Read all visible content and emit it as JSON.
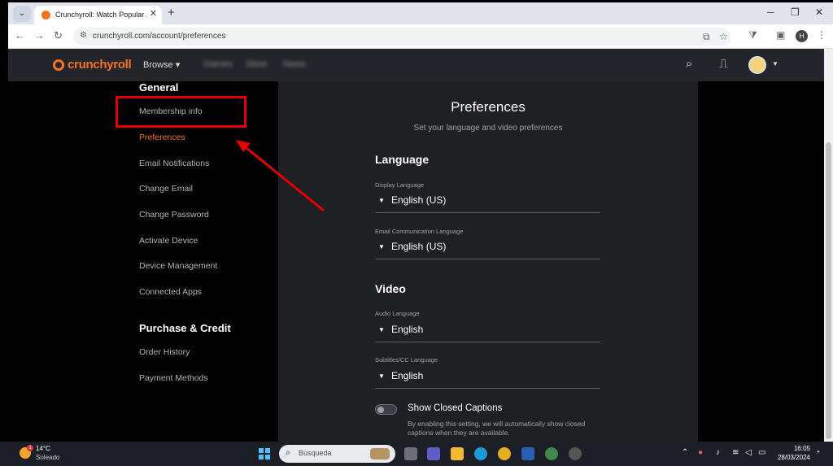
{
  "browser": {
    "tab_title": "Crunchyroll: Watch Popular An",
    "url": "crunchyroll.com/account/preferences",
    "profile_initial": "H"
  },
  "header": {
    "logo": "crunchyroll",
    "browse": "Browse",
    "blurred_items": [
      "Games",
      "Store",
      "News"
    ]
  },
  "sidebar": {
    "general_heading": "General",
    "general_items": [
      {
        "label": "Membership info",
        "active": false
      },
      {
        "label": "Preferences",
        "active": true
      },
      {
        "label": "Email Notifications",
        "active": false
      },
      {
        "label": "Change Email",
        "active": false
      },
      {
        "label": "Change Password",
        "active": false
      },
      {
        "label": "Activate Device",
        "active": false
      },
      {
        "label": "Device Management",
        "active": false
      },
      {
        "label": "Connected Apps",
        "active": false
      }
    ],
    "purchase_heading": "Purchase & Credit",
    "purchase_items": [
      {
        "label": "Order History"
      },
      {
        "label": "Payment Methods"
      }
    ]
  },
  "main": {
    "title": "Preferences",
    "subtitle": "Set your language and video preferences",
    "language_section": "Language",
    "display_language_label": "Display Language",
    "display_language_value": "English (US)",
    "email_language_label": "Email Communication Language",
    "email_language_value": "English (US)",
    "video_section": "Video",
    "audio_language_label": "Audio Language",
    "audio_language_value": "English",
    "subtitles_label": "Subtitles/CC Language",
    "subtitles_value": "English",
    "closed_captions_label": "Show Closed Captions",
    "closed_captions_desc": "By enabling this setting, we will automatically show closed captions when they are available.",
    "closed_captions_on": false
  },
  "taskbar": {
    "weather_temp": "14°C",
    "weather_desc": "Soleado",
    "weather_badge": "1",
    "search_placeholder": "Búsqueda",
    "time": "16:05",
    "date": "28/03/2024"
  },
  "colors": {
    "accent": "#f47521",
    "annotation": "#e30000"
  }
}
